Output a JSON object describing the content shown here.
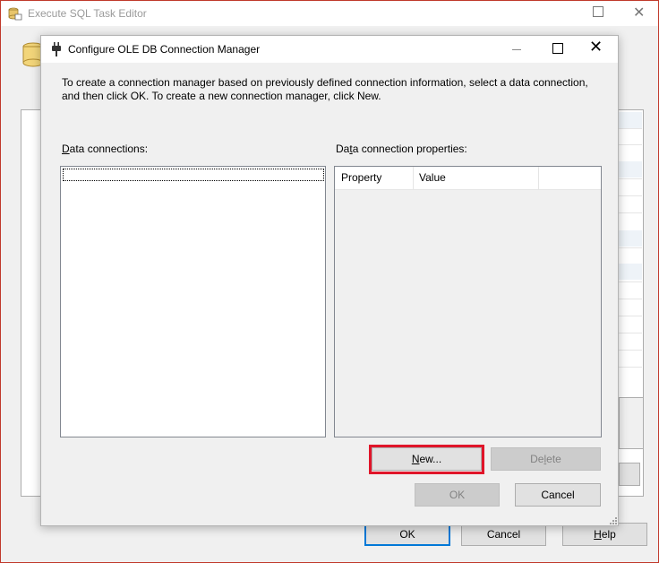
{
  "background_window": {
    "title": "Execute SQL Task Editor",
    "buttons": {
      "ok": "OK",
      "cancel": "Cancel",
      "help": "Help"
    }
  },
  "dialog": {
    "title": "Configure OLE DB Connection Manager",
    "intro_text": "To create a connection manager based on previously defined connection information, select a data connection, and then click OK. To create a new connection manager, click New.",
    "data_connections": {
      "label_prefix": "D",
      "label_rest": "ata connections:",
      "items": []
    },
    "data_connection_properties": {
      "label_prefix": "Da",
      "label_mnemonic": "t",
      "label_rest": "a connection properties:",
      "columns": [
        "Property",
        "Value"
      ],
      "rows": []
    },
    "buttons": {
      "new_prefix": "",
      "new_mnemonic": "N",
      "new_rest": "ew...",
      "delete_prefix": "De",
      "delete_mnemonic": "l",
      "delete_rest": "ete",
      "ok": "OK",
      "cancel": "Cancel"
    },
    "highlight_color": "#e0152a"
  },
  "bg_help_prefix": "",
  "bg_help_mnemonic": "H",
  "bg_help_rest": "elp"
}
